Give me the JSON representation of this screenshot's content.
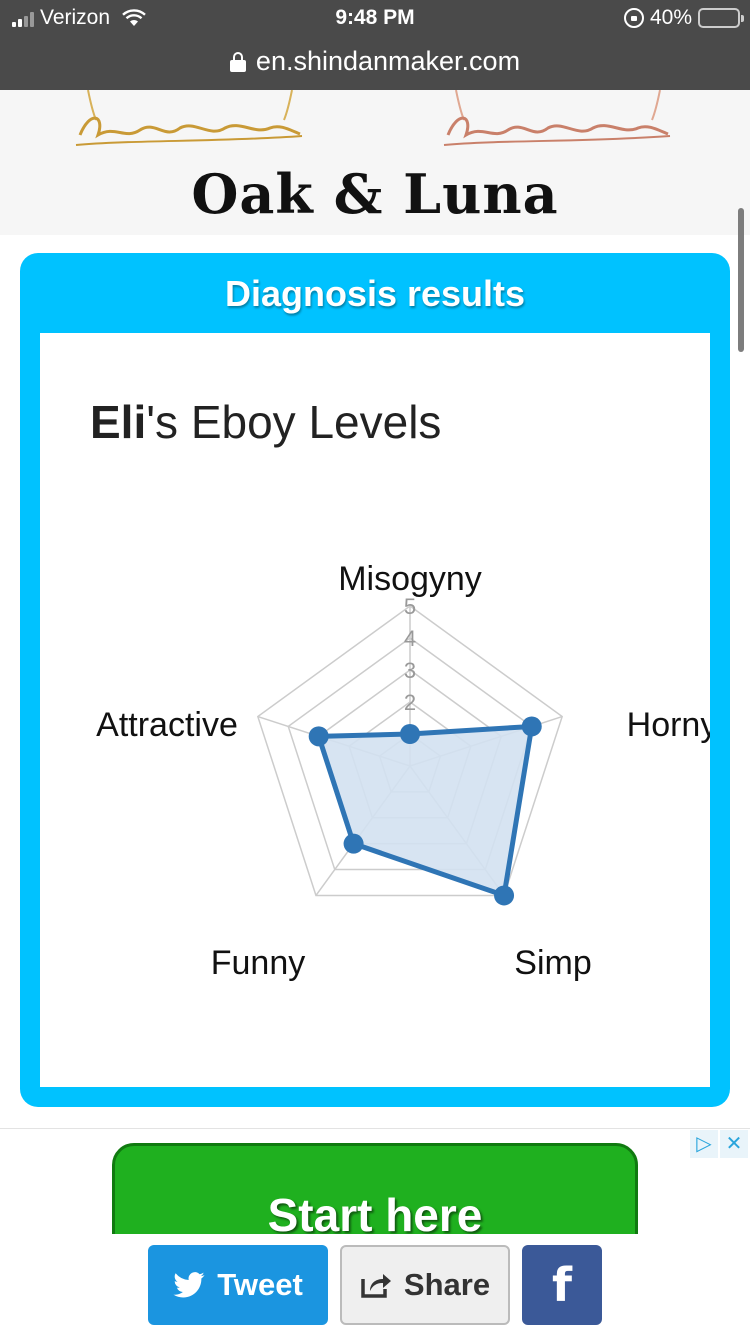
{
  "status_bar": {
    "carrier": "Verizon",
    "time": "9:48 PM",
    "battery_percent": "40%",
    "battery_level": 0.4
  },
  "browser": {
    "url": "en.shindanmaker.com"
  },
  "banner": {
    "brand": "Oak & Luna"
  },
  "result_card": {
    "header": "Diagnosis results",
    "name": "Eli",
    "title_suffix": "'s Eboy Levels"
  },
  "chart_data": {
    "type": "radar",
    "axes": [
      "Misogyny",
      "Horny",
      "Simp",
      "Funny",
      "Attractive"
    ],
    "scale": {
      "min": 0,
      "max": 5,
      "ticks": [
        "2",
        "3",
        "4",
        "5"
      ]
    },
    "values": [
      1,
      4,
      5,
      3,
      3
    ],
    "series_color": "#2f75b5",
    "fill_color": "#d3e1f1",
    "grid_color": "#cccccc"
  },
  "ad": {
    "button_label": "Start here",
    "badge_icons": [
      "adchoices-icon",
      "close-icon"
    ]
  },
  "share_bar": {
    "tweet_label": "Tweet",
    "share_label": "Share",
    "facebook_label": "f"
  },
  "colors": {
    "card_accent": "#00c2ff",
    "tweet": "#1b95e0",
    "facebook": "#3b5998"
  }
}
